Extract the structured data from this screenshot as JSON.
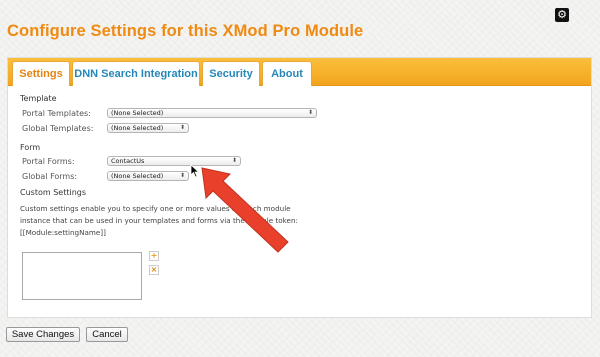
{
  "page": {
    "title": "Configure Settings for this XMod Pro Module"
  },
  "tabs": [
    {
      "label": "Settings",
      "active": true
    },
    {
      "label": "DNN Search Integration",
      "active": false
    },
    {
      "label": "Security",
      "active": false
    },
    {
      "label": "About",
      "active": false
    }
  ],
  "template_section": {
    "heading": "Template",
    "portal_label": "Portal Templates:",
    "portal_value": "(None Selected)",
    "global_label": "Global Templates:",
    "global_value": "(None Selected)"
  },
  "form_section": {
    "heading": "Form",
    "portal_label": "Portal Forms:",
    "portal_value": "ContactUs",
    "global_label": "Global Forms:",
    "global_value": "(None Selected)"
  },
  "custom_section": {
    "heading": "Custom Settings",
    "description": "Custom settings enable you to specify one or more values for each module instance that can be used in your templates and forms via the Module token: [[Module:settingName]]",
    "add_label": "+",
    "remove_label": "×"
  },
  "footer": {
    "save_label": "Save Changes",
    "cancel_label": "Cancel"
  },
  "icons": {
    "settings": "gear-icon",
    "chevron": "chevron-updown-icon",
    "add": "plus-icon",
    "remove": "x-icon"
  },
  "colors": {
    "title": "#ef8a12",
    "tab_bar": "#f5a623",
    "tab_text": "#2487b9",
    "active_tab_text": "#e48312",
    "arrow": "#e8402a"
  }
}
